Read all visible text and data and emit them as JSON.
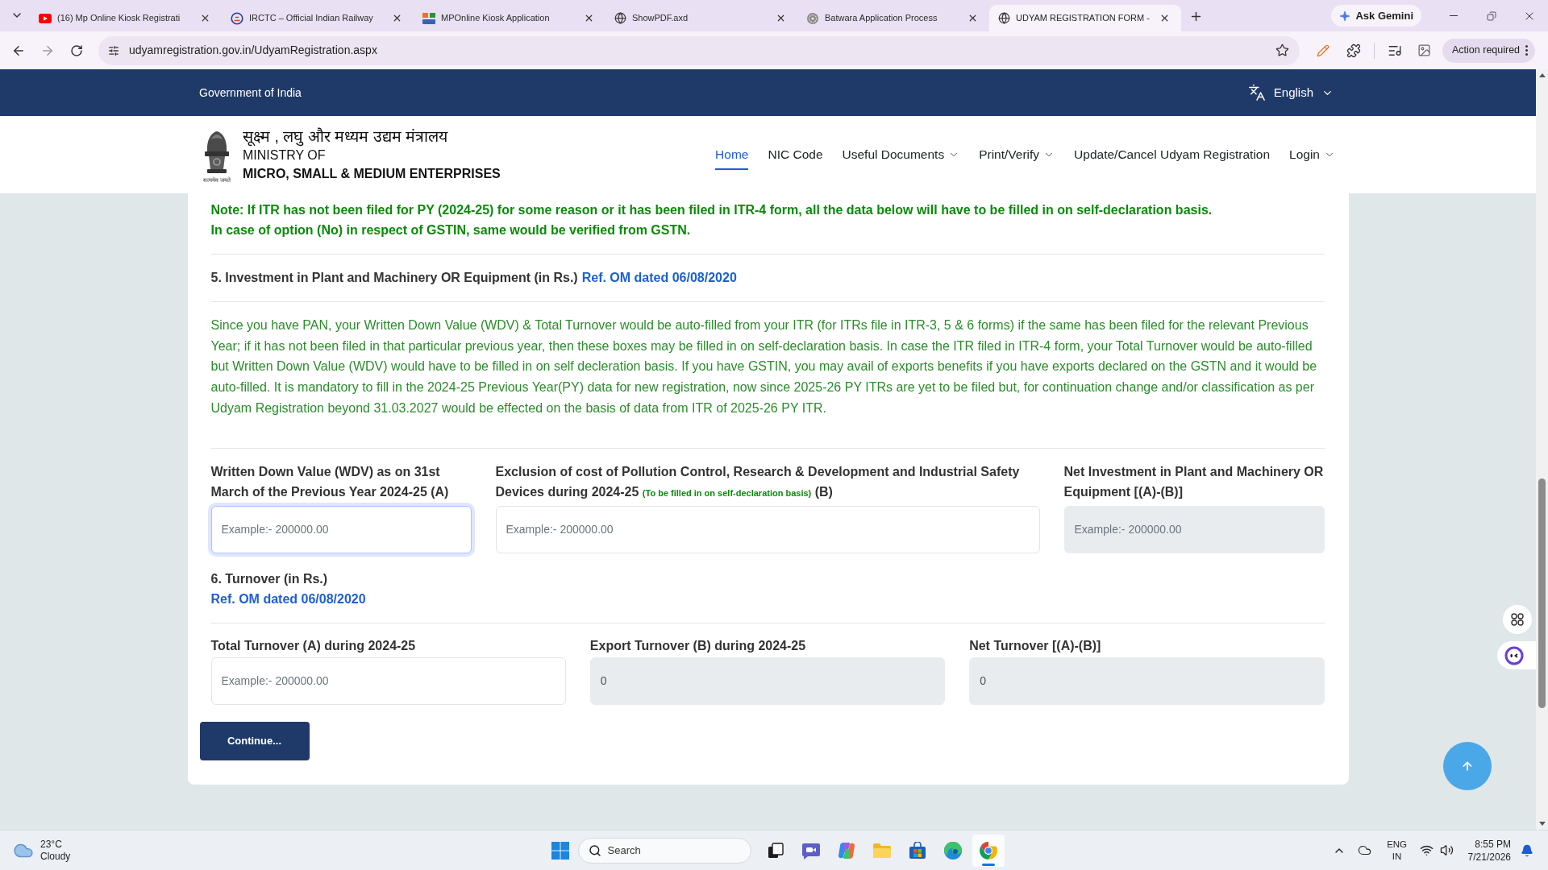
{
  "browser": {
    "tabs": [
      {
        "kind": "youtube",
        "title": "(16) Mp Online Kiosk Registrati",
        "selected": false
      },
      {
        "kind": "train",
        "title": "IRCTC – Official Indian Railway",
        "selected": false
      },
      {
        "kind": "logo",
        "title": "MPOnline Kiosk Application",
        "selected": false
      },
      {
        "kind": "globe",
        "title": "ShowPDF.axd",
        "selected": false
      },
      {
        "kind": "seal",
        "title": "Batwara Application Process",
        "selected": false
      },
      {
        "kind": "globe",
        "title": "UDYAM REGISTRATION FORM -",
        "selected": true
      }
    ],
    "gemini": "Ask Gemini",
    "url": "udyamregistration.gov.in/UdyamRegistration.aspx",
    "profile_status": "Action required"
  },
  "gov_bar": {
    "title": "Government of India",
    "language": "English"
  },
  "header": {
    "ministry_hindi": "सूक्ष्म , लघु और मध्यम उद्यम मंत्रालय",
    "ministry_of": "MINISTRY OF",
    "ministry_name": "MICRO, SMALL & MEDIUM ENTERPRISES",
    "emblem_motto": "सत्यमेव जयते"
  },
  "nav": {
    "items": [
      {
        "label": "Home",
        "selected": true,
        "has_menu": false
      },
      {
        "label": "NIC Code",
        "selected": false,
        "has_menu": false
      },
      {
        "label": "Useful Documents",
        "selected": false,
        "has_menu": true
      },
      {
        "label": "Print/Verify",
        "selected": false,
        "has_menu": true
      },
      {
        "label": "Update/Cancel Udyam Registration",
        "selected": false,
        "has_menu": false
      },
      {
        "label": "Login",
        "selected": false,
        "has_menu": true
      }
    ]
  },
  "form": {
    "notes": [
      "Note: If ITR has not been filed for PY (2024-25) for some reason or it has been filed in ITR-4 form, all the data below will have to be filled in on self-declaration basis.",
      "In case of option (No) in respect of GSTIN, same would be verified from GSTN."
    ],
    "investment": {
      "heading": "5. Investment in Plant and Machinery OR Equipment (in Rs.)",
      "ref_link": "Ref. OM dated 06/08/2020",
      "info": "Since you have PAN, your Written Down Value (WDV) & Total Turnover would be auto-filled from your ITR (for ITRs file in ITR-3, 5 & 6 forms) if the same has been filed for the relevant Previous Year; if it has not been filed in that particular previous year, then these boxes may be filled in on self-declaration basis. In case the ITR filed in ITR-4 form, your Total Turnover would be auto-filled but Written Down Value (WDV) would have to be filled in on self decleration basis. If you have GSTIN, you may avail of exports benefits if you have exports declared on the GSTN and it would be auto-filled. It is mandatory to fill in the 2024-25 Previous Year(PY) data for new registration, now since 2025-26 PY ITRs are yet to be filed but, for continuation change and/or classification as per Udyam Registration beyond 31.03.2027 would be effected on the basis of data from ITR of 2025-26 PY ITR.",
      "fields": [
        {
          "label": "Written Down Value (WDV) as on 31st March of the Previous Year 2024-25 (A)",
          "placeholder": "Example:- 200000.00",
          "focused": true,
          "disabled": false
        },
        {
          "label": "Exclusion of cost of Pollution Control, Research & Development and Industrial Safety Devices during 2024-25",
          "hint": "(To be filled in on self-declaration basis)",
          "label_suffix": "(B)",
          "placeholder": "Example:- 200000.00",
          "focused": false,
          "disabled": false
        },
        {
          "label": "Net Investment in Plant and Machinery OR Equipment [(A)-(B)]",
          "placeholder": "Example:- 200000.00",
          "focused": false,
          "disabled": true
        }
      ]
    },
    "turnover": {
      "heading": "6. Turnover (in Rs.)",
      "ref_link": "Ref. OM dated 06/08/2020",
      "fields": [
        {
          "label": "Total Turnover (A) during 2024-25",
          "placeholder": "Example:- 200000.00",
          "focused": false,
          "disabled": false
        },
        {
          "label": "Export Turnover (B) during 2024-25",
          "value": "0",
          "focused": false,
          "disabled": true
        },
        {
          "label": "Net Turnover [(A)-(B)]",
          "value": "0",
          "focused": false,
          "disabled": true
        }
      ]
    },
    "continue": "Continue..."
  },
  "taskbar": {
    "weather": {
      "temperature": "23°C",
      "condition": "Cloudy"
    },
    "search": {
      "placeholder": "Search"
    },
    "apps": [
      {
        "kind": "task-view",
        "selected": false
      },
      {
        "kind": "chat",
        "selected": false
      },
      {
        "kind": "assistant",
        "selected": false
      },
      {
        "kind": "folder",
        "selected": false
      },
      {
        "kind": "store",
        "selected": false
      },
      {
        "kind": "edge",
        "selected": false
      },
      {
        "kind": "chrome",
        "selected": true
      }
    ],
    "language": {
      "input": "ENG",
      "region": "IN"
    },
    "time": "8:55 PM",
    "date": "7/21/2026"
  }
}
